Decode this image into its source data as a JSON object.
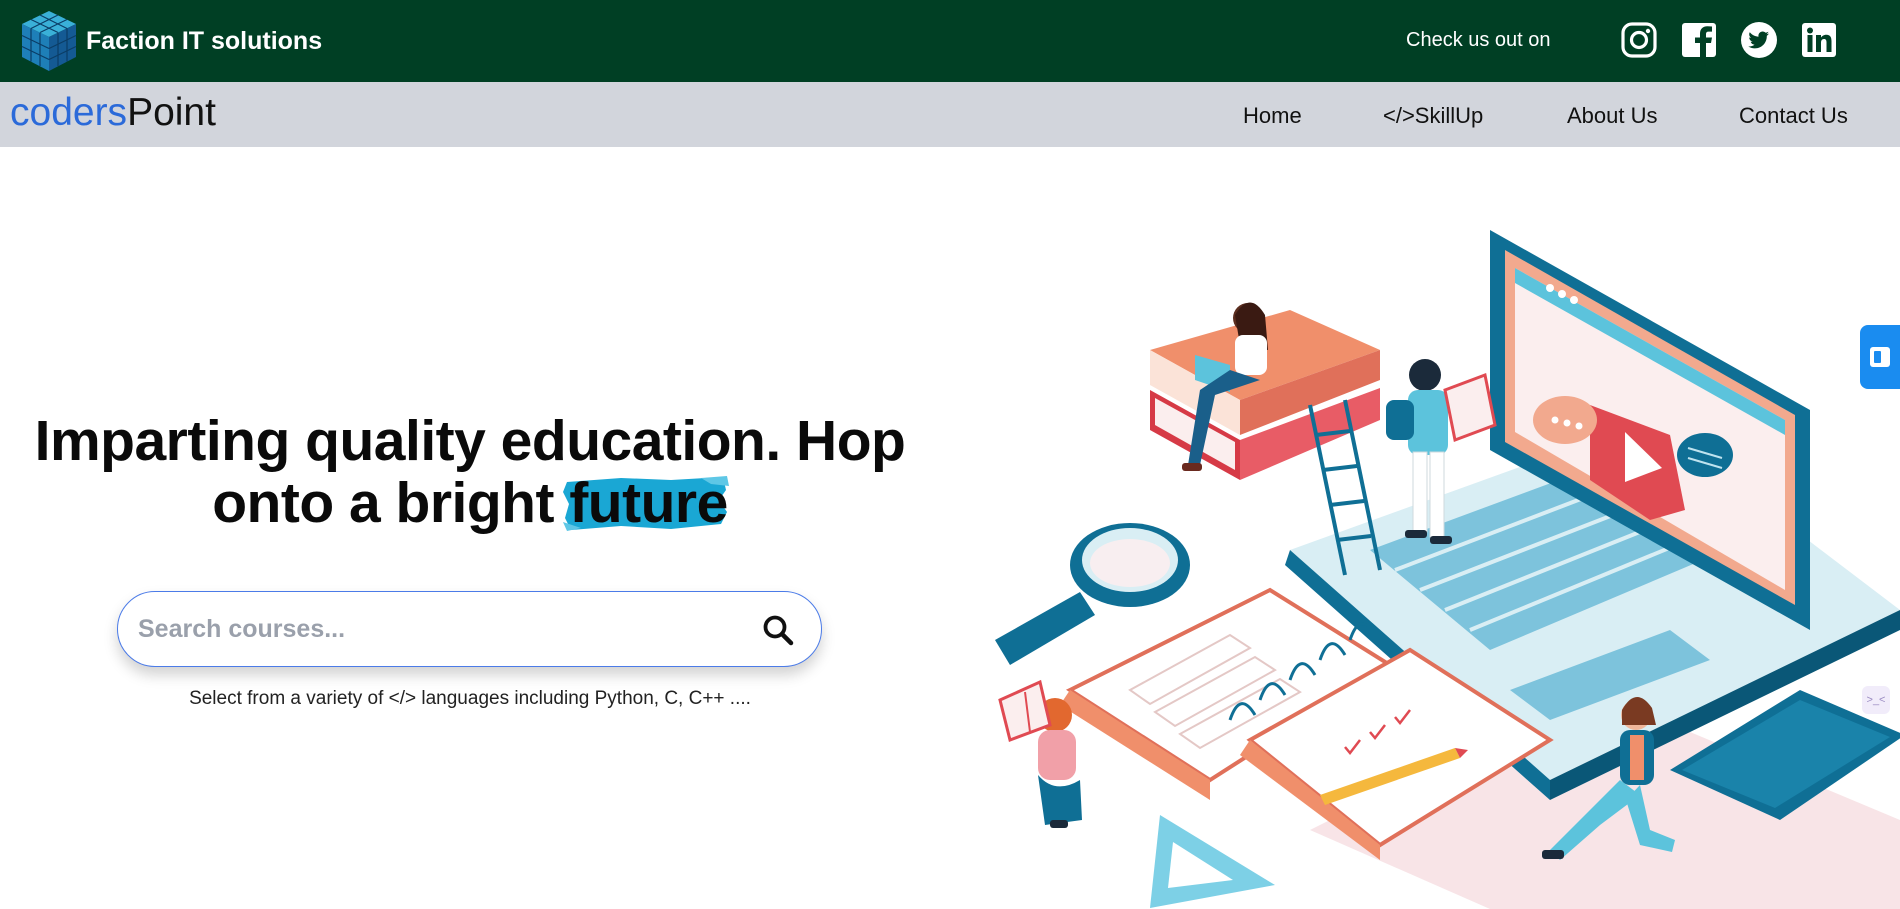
{
  "topbar": {
    "brand_name": "Faction IT solutions",
    "checkout_text": "Check us out on",
    "social": [
      "instagram-icon",
      "facebook-icon",
      "twitter-icon",
      "linkedin-icon"
    ]
  },
  "navbar": {
    "logo_part1": "coders",
    "logo_part2": "Point",
    "links": [
      "Home",
      "</>SkillUp",
      "About Us",
      "Contact Us"
    ]
  },
  "hero": {
    "headline_line1": "Imparting quality education. Hop",
    "headline_line2_pre": "onto a bright ",
    "headline_highlight": "future",
    "search_placeholder": "Search courses...",
    "subtext": "Select from a variety of </> languages including Python, C, C++ ....",
    "side_mini_text": ">_<"
  },
  "colors": {
    "topbar": "#003f24",
    "navbar": "#d2d5dc",
    "accent_blue": "#2b6ad9",
    "highlight": "#1aa7d4"
  }
}
